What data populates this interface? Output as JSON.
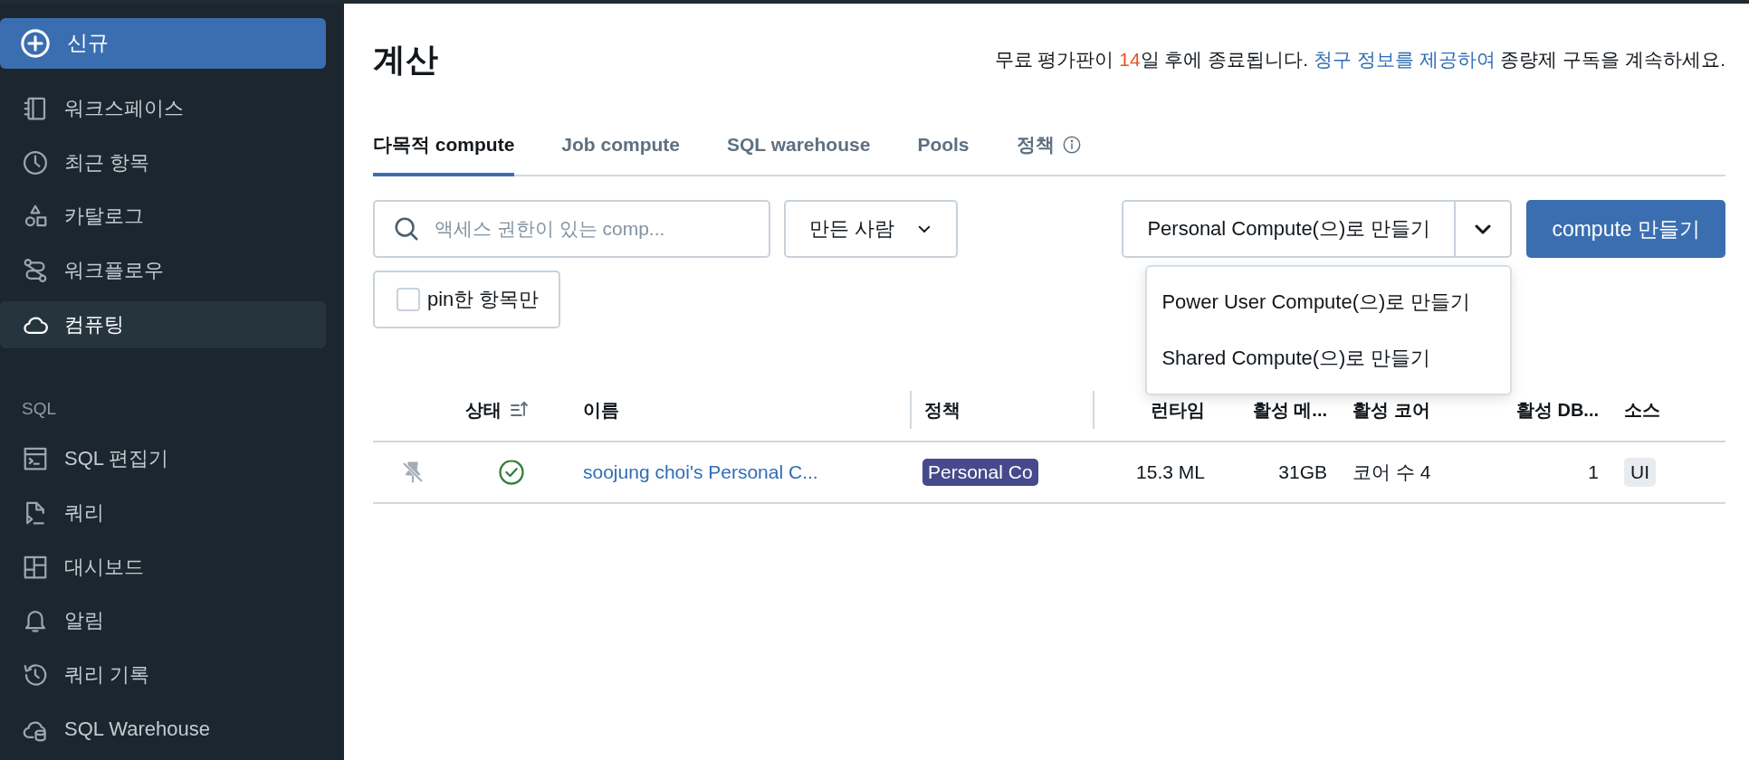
{
  "sidebar": {
    "new_button": "신규",
    "items": [
      {
        "label": "워크스페이스",
        "selected": false
      },
      {
        "label": "최근 항목",
        "selected": false
      },
      {
        "label": "카탈로그",
        "selected": false
      },
      {
        "label": "워크플로우",
        "selected": false
      },
      {
        "label": "컴퓨팅",
        "selected": true
      }
    ],
    "sql_section": {
      "heading": "SQL",
      "items": [
        {
          "label": "SQL 편집기",
          "selected": false
        },
        {
          "label": "쿼리",
          "selected": false
        },
        {
          "label": "대시보드",
          "selected": false
        },
        {
          "label": "알림",
          "selected": false
        },
        {
          "label": "쿼리 기록",
          "selected": false
        },
        {
          "label": "SQL Warehouse",
          "selected": false
        }
      ]
    }
  },
  "page": {
    "title": "계산",
    "trial_notice": [
      {
        "text": "무료 평가판이 ",
        "kind": "plain"
      },
      {
        "text": "14",
        "kind": "emphasis"
      },
      {
        "text": "일 후에 종료됩니다. ",
        "kind": "plain"
      },
      {
        "text": "청구 정보를 제공하여",
        "kind": "link"
      },
      {
        "text": " 종량제 구독을 계속하세요.",
        "kind": "plain"
      }
    ]
  },
  "tabs": [
    {
      "label": "다목적 compute",
      "selected": true,
      "info": false
    },
    {
      "label": "Job compute",
      "selected": false,
      "info": false
    },
    {
      "label": "SQL warehouse",
      "selected": false,
      "info": false
    },
    {
      "label": "Pools",
      "selected": false,
      "info": false
    },
    {
      "label": "정책",
      "selected": false,
      "info": true
    }
  ],
  "toolbar": {
    "search": {
      "placeholder": "액세스 권한이 있는 comp..."
    },
    "creator_filter": "만든 사람",
    "split_button": {
      "label": "Personal Compute(으)로 만들기",
      "expanded": true,
      "menu": [
        "Power User Compute(으)로 만들기",
        "Shared Compute(으)로 만들기"
      ]
    },
    "create_button": "compute 만들기",
    "pinned_only": {
      "label": "pin한 항목만",
      "checked": false
    }
  },
  "table": {
    "columns": [
      {
        "label": "상태",
        "sorted": true
      },
      {
        "label": "이름",
        "sorted": false
      },
      {
        "label": "정책",
        "sorted": false
      },
      {
        "label": "런타임",
        "sorted": false
      },
      {
        "label": "활성 메...",
        "sorted": false
      },
      {
        "label": "활성 코어",
        "sorted": false
      },
      {
        "label": "활성 DB...",
        "sorted": false
      },
      {
        "label": "소스",
        "sorted": false
      }
    ],
    "rows": [
      {
        "pinned": false,
        "running": true,
        "name": "soojung choi's Personal C...",
        "policy": "Personal Co",
        "runtime": "15.3 ML",
        "memory": "31GB",
        "cores": "코어 수 4",
        "dbu": "1",
        "source": "UI"
      }
    ]
  }
}
